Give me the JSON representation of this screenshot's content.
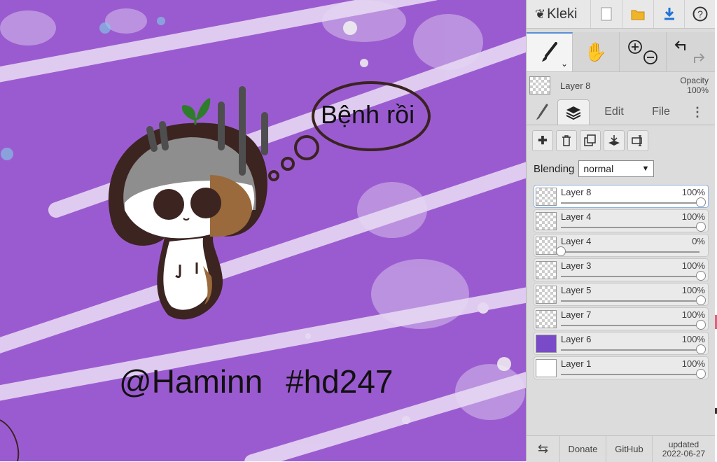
{
  "app": {
    "name": "Kleki",
    "logo_icon": "kleki-logo-icon"
  },
  "topbar": {
    "icons": [
      "new-image-icon",
      "open-folder-icon",
      "download-icon",
      "help-icon"
    ],
    "help_glyph": "?"
  },
  "canvas": {
    "background_color": "#9b5bd0",
    "bubble_text": "Bệnh rồi",
    "signature_text": "@Haminn   #hd247"
  },
  "tools": [
    {
      "id": "brush",
      "icon": "brush-icon",
      "active": true
    },
    {
      "id": "hand",
      "icon": "hand-icon",
      "active": false
    },
    {
      "id": "zoom",
      "icon": "zoom-in-out-icon",
      "active": false
    },
    {
      "id": "history",
      "icon": "undo-redo-icon",
      "active": false
    }
  ],
  "current_layer": {
    "name": "Layer 8",
    "opacity_label": "Opacity",
    "opacity_value": "100%"
  },
  "tabs": {
    "brush_icon": "brush-tab-icon",
    "layers_icon": "layers-tab-icon",
    "edit": "Edit",
    "file": "File",
    "more_icon": "more-vertical-icon"
  },
  "layer_actions": [
    "add-layer-icon",
    "delete-layer-icon",
    "duplicate-layer-icon",
    "merge-down-icon",
    "rename-layer-icon"
  ],
  "blending": {
    "label": "Blending",
    "value": "normal"
  },
  "layers": [
    {
      "name": "Layer 8",
      "opacity": "100%",
      "level": 1.0,
      "selected": true,
      "thumb": "checker"
    },
    {
      "name": "Layer 4",
      "opacity": "100%",
      "level": 1.0,
      "selected": false,
      "thumb": "checker"
    },
    {
      "name": "Layer 4",
      "opacity": "0%",
      "level": 0.0,
      "selected": false,
      "thumb": "checker"
    },
    {
      "name": "Layer 3",
      "opacity": "100%",
      "level": 1.0,
      "selected": false,
      "thumb": "checker"
    },
    {
      "name": "Layer 5",
      "opacity": "100%",
      "level": 1.0,
      "selected": false,
      "thumb": "checker"
    },
    {
      "name": "Layer 7",
      "opacity": "100%",
      "level": 1.0,
      "selected": false,
      "thumb": "checker"
    },
    {
      "name": "Layer 6",
      "opacity": "100%",
      "level": 1.0,
      "selected": false,
      "thumb": "purple"
    },
    {
      "name": "Layer 1",
      "opacity": "100%",
      "level": 1.0,
      "selected": false,
      "thumb": "white"
    }
  ],
  "footer": {
    "swap_icon": "swap-sides-icon",
    "donate": "Donate",
    "github": "GitHub",
    "updated_label": "updated",
    "updated_date": "2022-06-27"
  }
}
